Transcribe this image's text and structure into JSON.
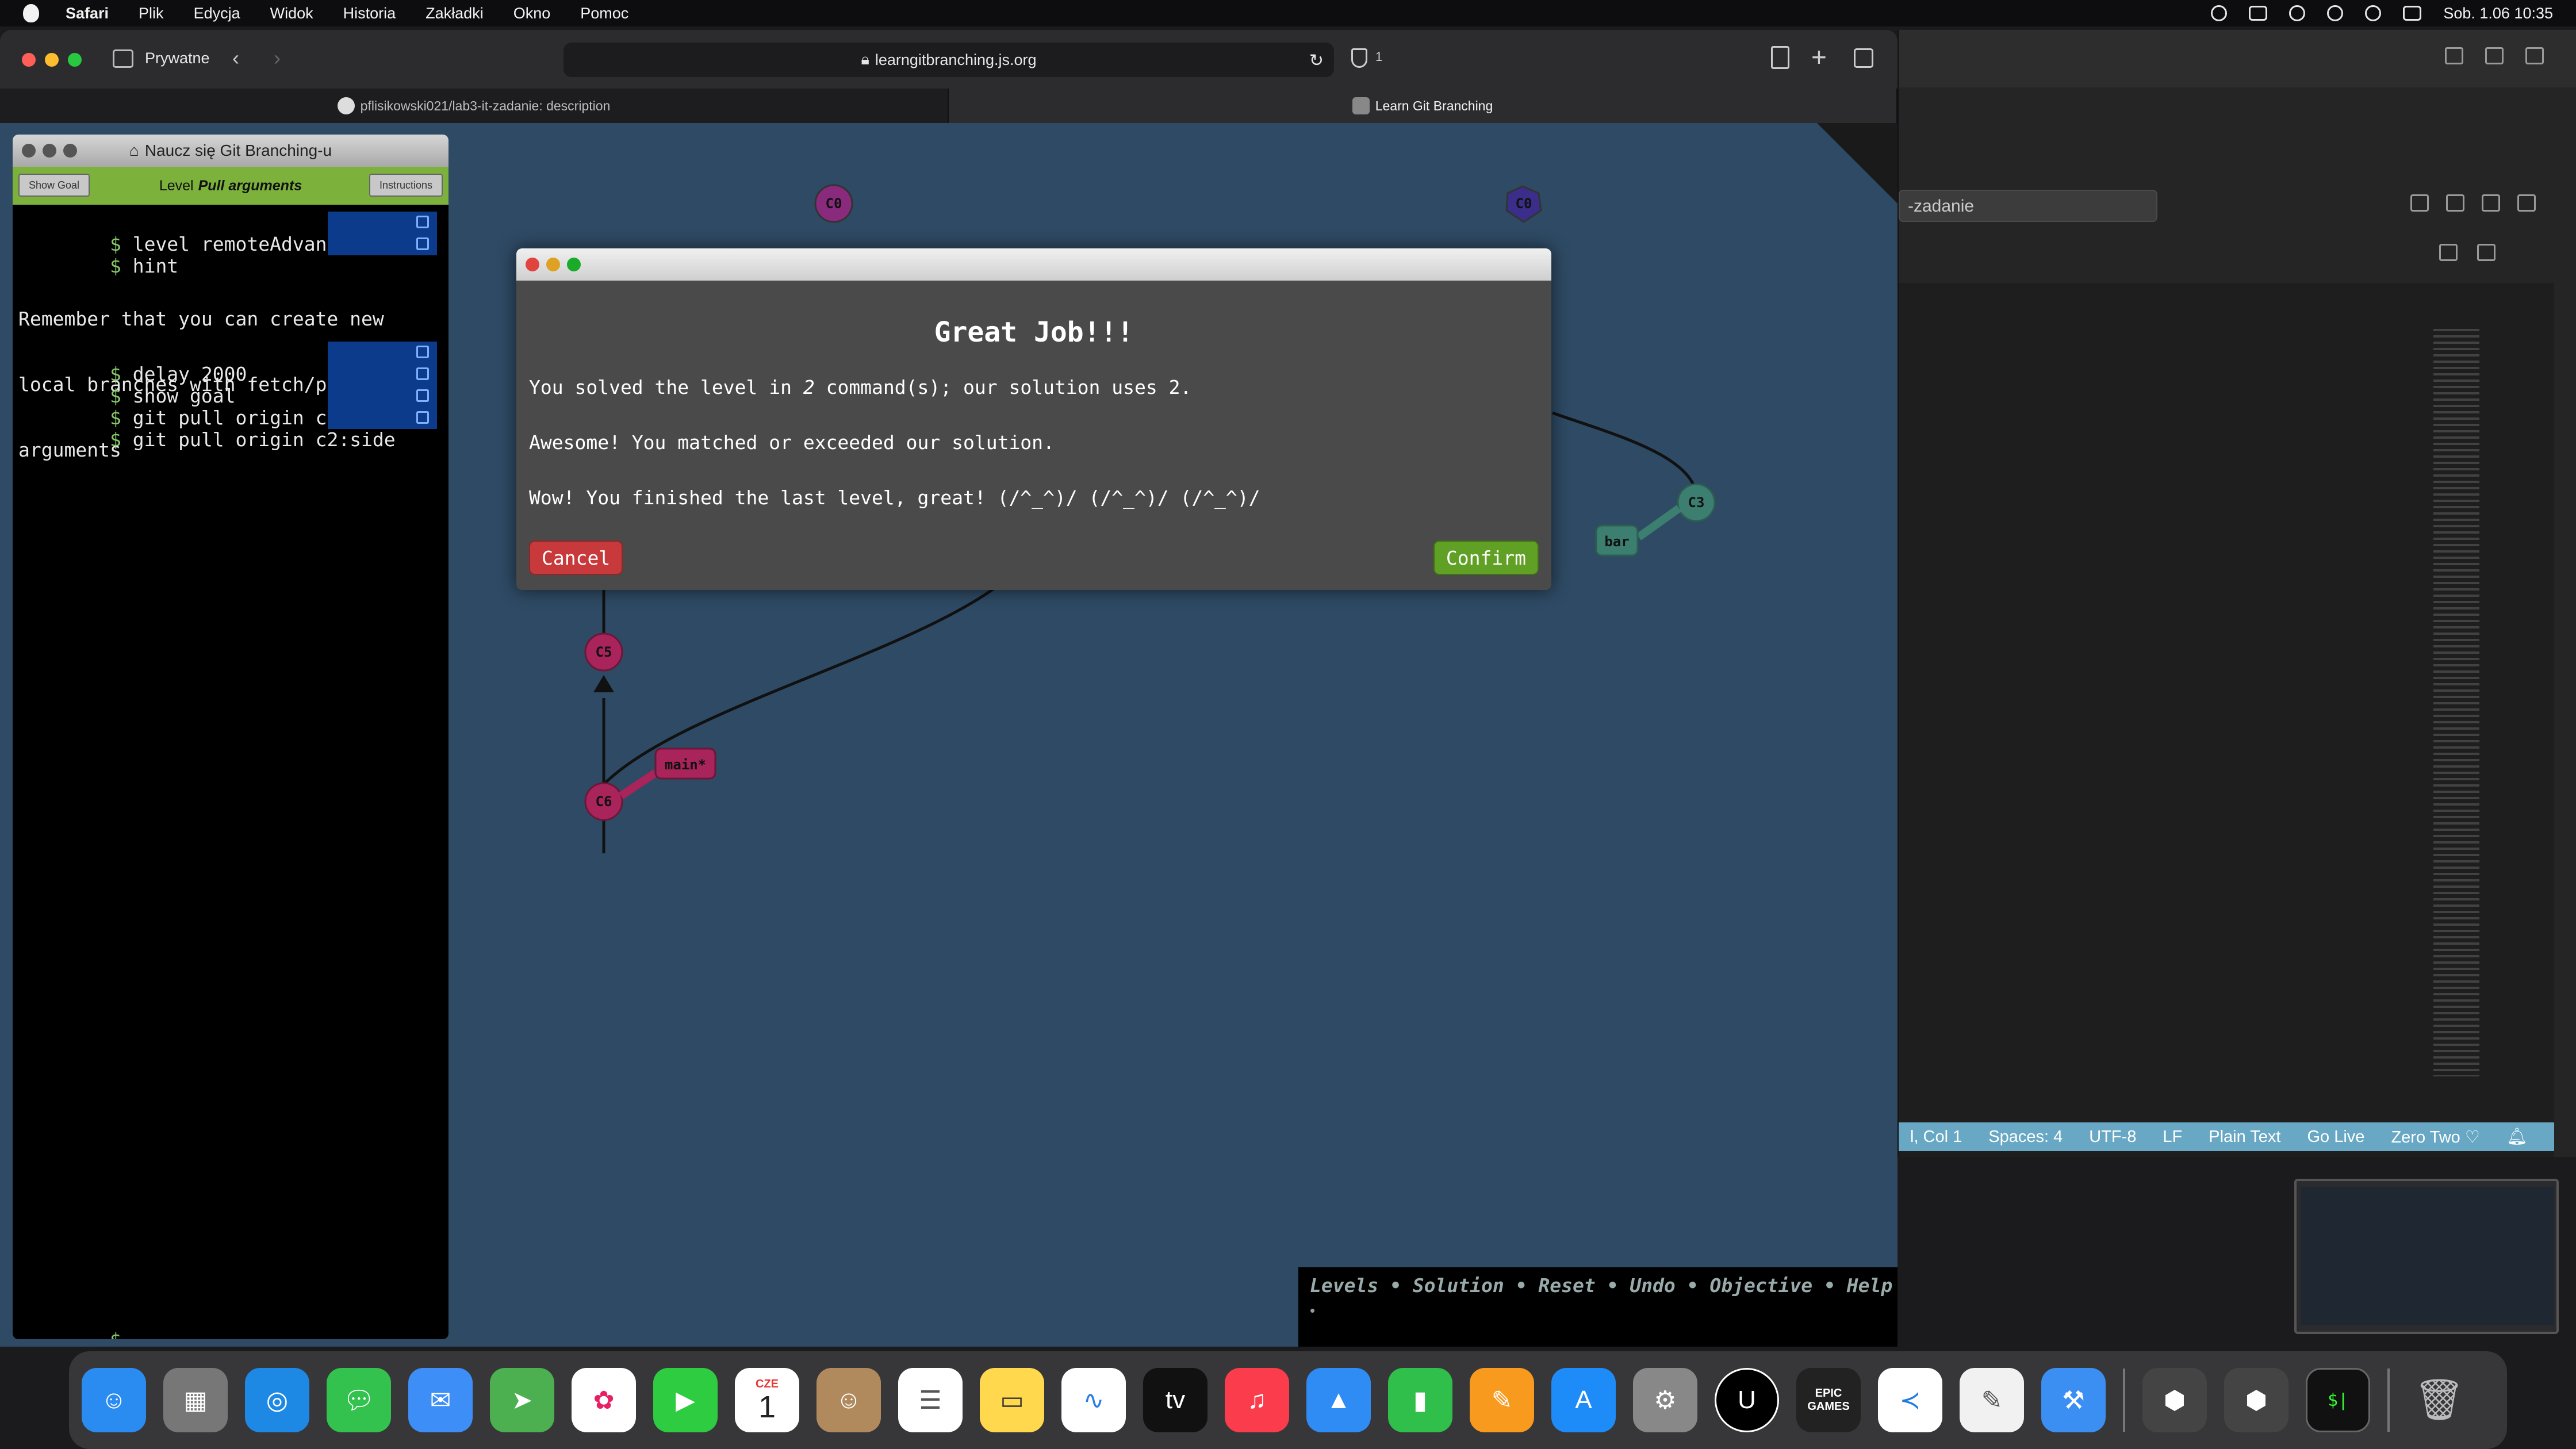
{
  "menubar": {
    "items": [
      "Safari",
      "Plik",
      "Edycja",
      "Widok",
      "Historia",
      "Zakładki",
      "Okno",
      "Pomoc"
    ],
    "datetime": "Sob. 1.06  10:35"
  },
  "safari": {
    "private_label": "Prywatne",
    "url": "learngitbranching.js.org",
    "shield_count": "1",
    "tabs": [
      {
        "label": "pflisikowski021/lab3-it-zadanie: description",
        "active": false
      },
      {
        "label": "Learn Git Branching",
        "active": true
      }
    ]
  },
  "command_panel": {
    "title": "Naucz się Git Branching-u",
    "show_goal": "Show Goal",
    "instructions": "Instructions",
    "level_prefix": "Level",
    "level_name": "Pull arguments",
    "history_top": [
      "level remoteAdvanced8",
      "hint"
    ],
    "hint_text": [
      "Remember that you can create new",
      "local branches with fetch/pull",
      "arguments"
    ],
    "history_bottom": [
      "delay 2000",
      "show goal",
      "git pull origin c3:foo",
      "git pull origin c2:side"
    ],
    "prompt": "$"
  },
  "tree": {
    "nodes": [
      {
        "id": "C0",
        "color": "#8a2a7c"
      },
      {
        "id": "C0",
        "color": "#3a2e8a"
      },
      {
        "id": "C3",
        "color": "#3c7f70"
      },
      {
        "id": "C5",
        "color": "#a8245a"
      },
      {
        "id": "C6",
        "color": "#a8245a"
      }
    ],
    "branches": [
      {
        "name": "bar",
        "color": "#3c7f70"
      },
      {
        "name": "main*",
        "color": "#a8245a"
      }
    ]
  },
  "modal": {
    "title": "Great Job!!!",
    "line1_prefix": "You solved the level in ",
    "line1_count": "2",
    "line1_suffix": " command(s); our solution uses 2.",
    "line2": "Awesome! You matched or exceeded our solution.",
    "line3": "Wow! You finished the last level, great! (/^_^)/ (/^_^)/ (/^_^)/",
    "cancel": "Cancel",
    "confirm": "Confirm"
  },
  "cmdbar": {
    "links": "Levels • Solution • Reset • Undo • Objective • Help",
    "prompt": "•"
  },
  "vscode": {
    "search_text": "-zadanie",
    "status": [
      "l, Col 1",
      "Spaces: 4",
      "UTF-8",
      "LF",
      "Plain Text",
      "Go Live",
      "Zero Two ♡"
    ]
  },
  "dock": {
    "calendar_month": "CZE",
    "calendar_day": "1",
    "apple_tv_label": "tv",
    "epic_label": "EPIC\nGAMES",
    "terminal_label": "$|"
  }
}
